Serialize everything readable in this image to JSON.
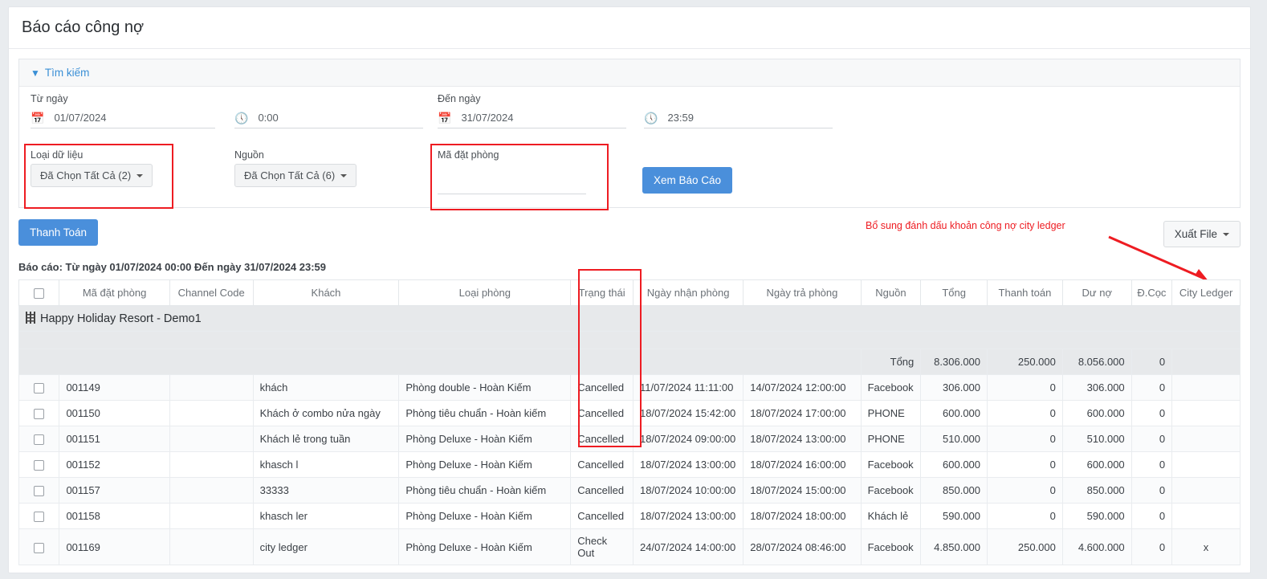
{
  "page": {
    "title": "Báo cáo công nợ"
  },
  "search": {
    "header": "Tìm kiếm",
    "from_date_label": "Từ ngày",
    "from_date_value": "01/07/2024",
    "from_time_value": "0:00",
    "to_date_label": "Đến ngày",
    "to_date_value": "31/07/2024",
    "to_time_value": "23:59",
    "data_type_label": "Loại dữ liệu",
    "data_type_value": "Đã Chọn Tất Cả (2)",
    "source_label": "Nguồn",
    "source_value": "Đã Chọn Tất Cả (6)",
    "booking_code_label": "Mã đặt phòng",
    "booking_code_value": "",
    "view_report_button": "Xem Báo Cáo"
  },
  "toolbar": {
    "payment_button": "Thanh Toán",
    "export_button": "Xuất File",
    "annotation": "Bổ sung đánh dấu khoản công nợ city ledger",
    "annotation_color": "#ee1c22"
  },
  "report_line": "Báo cáo: Từ ngày 01/07/2024 00:00 Đến ngày 31/07/2024 23:59",
  "table": {
    "columns": [
      "",
      "Mã đặt phòng",
      "Channel Code",
      "Khách",
      "Loại phòng",
      "Trạng thái",
      "Ngày nhận phòng",
      "Ngày trả phòng",
      "Nguồn",
      "Tổng",
      "Thanh toán",
      "Dư nợ",
      "Đ.Cọc",
      "City Ledger"
    ],
    "group_label": "Happy Holiday Resort - Demo1",
    "total_label": "Tổng",
    "totals": {
      "tong": "8.306.000",
      "thanh_toan": "250.000",
      "du_no": "8.056.000",
      "d_coc": "0"
    },
    "rows": [
      {
        "code": "001149",
        "channel": "",
        "guest": "khách",
        "room": "Phòng double - Hoàn Kiếm",
        "status": "Cancelled",
        "checkin": "11/07/2024 11:11:00",
        "checkout": "14/07/2024 12:00:00",
        "source": "Facebook",
        "tong": "306.000",
        "thanh_toan": "0",
        "du_no": "306.000",
        "d_coc": "0",
        "city_ledger": ""
      },
      {
        "code": "001150",
        "channel": "",
        "guest": "Khách ở combo nửa ngày",
        "room": "Phòng tiêu chuẩn - Hoàn kiếm",
        "status": "Cancelled",
        "checkin": "18/07/2024 15:42:00",
        "checkout": "18/07/2024 17:00:00",
        "source": "PHONE",
        "tong": "600.000",
        "thanh_toan": "0",
        "du_no": "600.000",
        "d_coc": "0",
        "city_ledger": ""
      },
      {
        "code": "001151",
        "channel": "",
        "guest": "Khách lẻ trong tuần",
        "room": "Phòng Deluxe - Hoàn Kiếm",
        "status": "Cancelled",
        "checkin": "18/07/2024 09:00:00",
        "checkout": "18/07/2024 13:00:00",
        "source": "PHONE",
        "tong": "510.000",
        "thanh_toan": "0",
        "du_no": "510.000",
        "d_coc": "0",
        "city_ledger": ""
      },
      {
        "code": "001152",
        "channel": "",
        "guest": "khasch l",
        "room": "Phòng Deluxe - Hoàn Kiếm",
        "status": "Cancelled",
        "checkin": "18/07/2024 13:00:00",
        "checkout": "18/07/2024 16:00:00",
        "source": "Facebook",
        "tong": "600.000",
        "thanh_toan": "0",
        "du_no": "600.000",
        "d_coc": "0",
        "city_ledger": ""
      },
      {
        "code": "001157",
        "channel": "",
        "guest": "33333",
        "room": "Phòng tiêu chuẩn - Hoàn kiếm",
        "status": "Cancelled",
        "checkin": "18/07/2024 10:00:00",
        "checkout": "18/07/2024 15:00:00",
        "source": "Facebook",
        "tong": "850.000",
        "thanh_toan": "0",
        "du_no": "850.000",
        "d_coc": "0",
        "city_ledger": ""
      },
      {
        "code": "001158",
        "channel": "",
        "guest": "khasch ler",
        "room": "Phòng Deluxe - Hoàn Kiếm",
        "status": "Cancelled",
        "checkin": "18/07/2024 13:00:00",
        "checkout": "18/07/2024 18:00:00",
        "source": "Khách lẻ",
        "tong": "590.000",
        "thanh_toan": "0",
        "du_no": "590.000",
        "d_coc": "0",
        "city_ledger": ""
      },
      {
        "code": "001169",
        "channel": "",
        "guest": "city ledger",
        "room": "Phòng Deluxe - Hoàn Kiếm",
        "status": "Check Out",
        "checkin": "24/07/2024 14:00:00",
        "checkout": "28/07/2024 08:46:00",
        "source": "Facebook",
        "tong": "4.850.000",
        "thanh_toan": "250.000",
        "du_no": "4.600.000",
        "d_coc": "0",
        "city_ledger": "x"
      }
    ]
  }
}
